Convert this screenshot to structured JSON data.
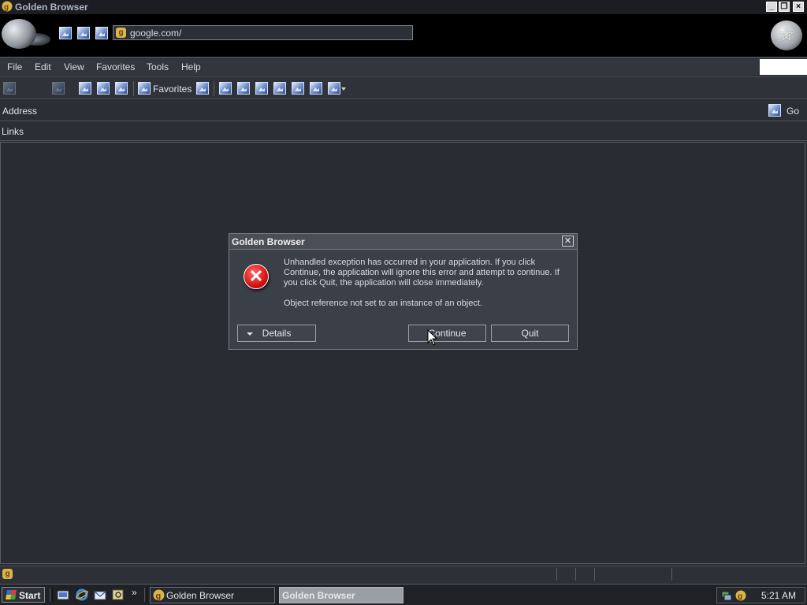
{
  "window": {
    "title": "Golden Browser",
    "buttons": [
      "minimize",
      "restore",
      "close"
    ]
  },
  "chrome": {
    "address_value": "google.com/",
    "icons": [
      "back-orb-icon",
      "image-icon",
      "image-icon",
      "image-icon",
      "favorites-star-icon"
    ]
  },
  "menubar": {
    "items": [
      "File",
      "Edit",
      "View",
      "Favorites",
      "Tools",
      "Help"
    ]
  },
  "toolbar": {
    "favorites_label": "Favorites"
  },
  "address_bar": {
    "label": "Address",
    "go_label": "Go"
  },
  "links_bar": {
    "label": "Links"
  },
  "dialog": {
    "title": "Golden Browser",
    "message": "Unhandled exception has occurred in your application. If you click Continue, the application will ignore this error and attempt to continue. If you click Quit, the application will close immediately.",
    "detail": "Object reference not set to an instance of an object.",
    "details_button": "Details",
    "continue_button": "Continue",
    "quit_button": "Quit",
    "icon": "error-icon"
  },
  "taskbar": {
    "start_label": "Start",
    "tasks": [
      "Golden Browser",
      "Golden Browser"
    ],
    "clock": "5:21 AM"
  },
  "colors": {
    "background": "#2a2d33",
    "titlebar": "#1b1d22",
    "dialog": "#3b3f47",
    "error_red": "#d41414",
    "active_task": "#9a9ea5"
  }
}
